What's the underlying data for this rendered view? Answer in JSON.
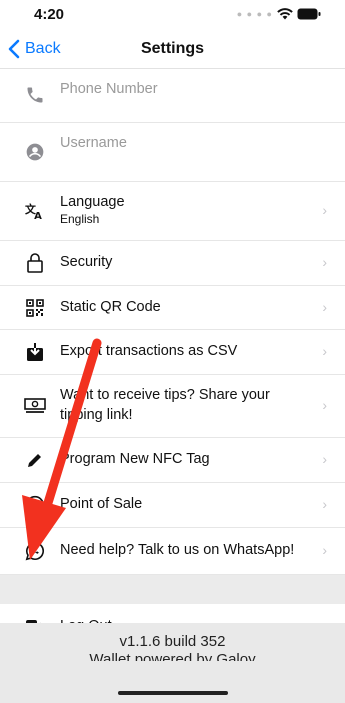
{
  "status_bar": {
    "time": "4:20"
  },
  "nav": {
    "back_label": "Back",
    "title": "Settings"
  },
  "rows": [
    {
      "label": "Phone Number",
      "muted": true,
      "icon": "phone-icon"
    },
    {
      "label": "Username",
      "muted": true,
      "icon": "user-circle-icon"
    },
    {
      "label": "Language",
      "sub": "English",
      "icon": "translate-icon"
    },
    {
      "label": "Security",
      "icon": "lock-icon"
    },
    {
      "label": "Static QR Code",
      "icon": "qr-code-icon"
    },
    {
      "label": "Export transactions as CSV",
      "icon": "download-icon"
    },
    {
      "label": "Want to receive tips? Share your",
      "sub": "tipping link!",
      "icon": "cash-icon"
    },
    {
      "label": "Program New NFC Tag",
      "icon": "pencil-icon"
    },
    {
      "label": "Point of Sale",
      "icon": "point-of-sale-icon"
    },
    {
      "label": "Need help? Talk to us on WhatsApp!",
      "icon": "whatsapp-icon"
    }
  ],
  "logout": {
    "label": "Log Out",
    "icon": "logout-icon"
  },
  "footer": {
    "version": "v1.1.6 build 352",
    "powered": "Wallet powered by Galoy"
  },
  "colors": {
    "accent": "#0a7aff",
    "annotation_arrow": "#f2311f"
  }
}
